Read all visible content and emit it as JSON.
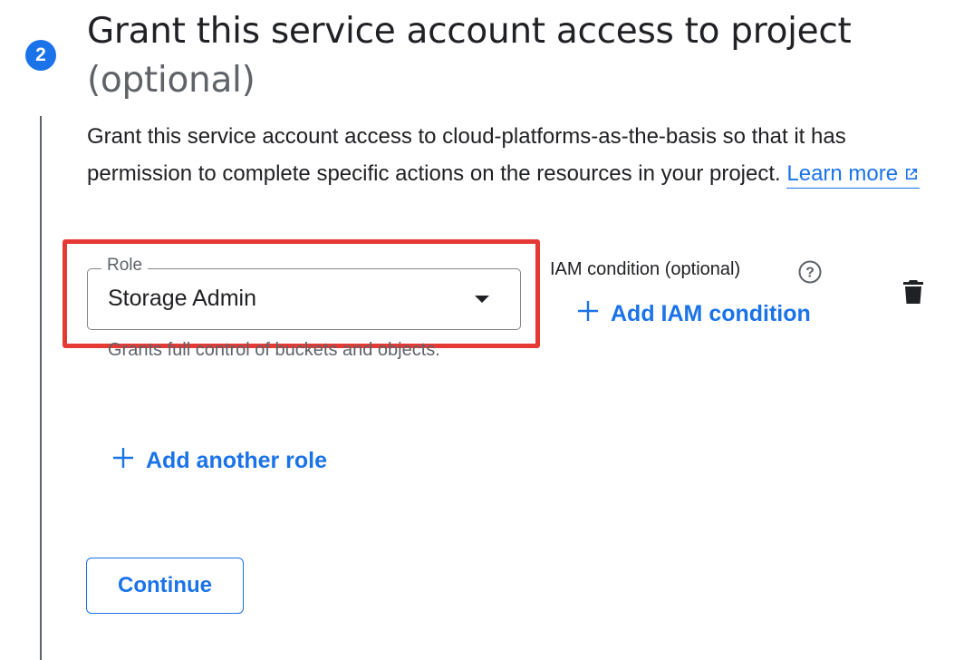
{
  "step": {
    "number": "2",
    "title": "Grant this service account access to project",
    "title_optional": "(optional)"
  },
  "description": {
    "text": "Grant this service account access to cloud-platforms-as-the-basis so that it has permission to complete specific actions on the resources in your project.",
    "learn_more": "Learn more"
  },
  "role": {
    "label": "Role",
    "value": "Storage Admin",
    "hint": "Grants full control of buckets and objects."
  },
  "iam_condition": {
    "label": "IAM condition (optional)",
    "add_button": "Add IAM condition"
  },
  "add_role_button": "Add another role",
  "continue_button": "Continue",
  "colors": {
    "accent": "#1a73e8",
    "highlight": "#e53935",
    "text": "#202124",
    "secondary_text": "#5f6368"
  },
  "icons": [
    "external-link-icon",
    "help-icon",
    "plus-icon",
    "trash-icon",
    "dropdown-arrow-icon"
  ]
}
